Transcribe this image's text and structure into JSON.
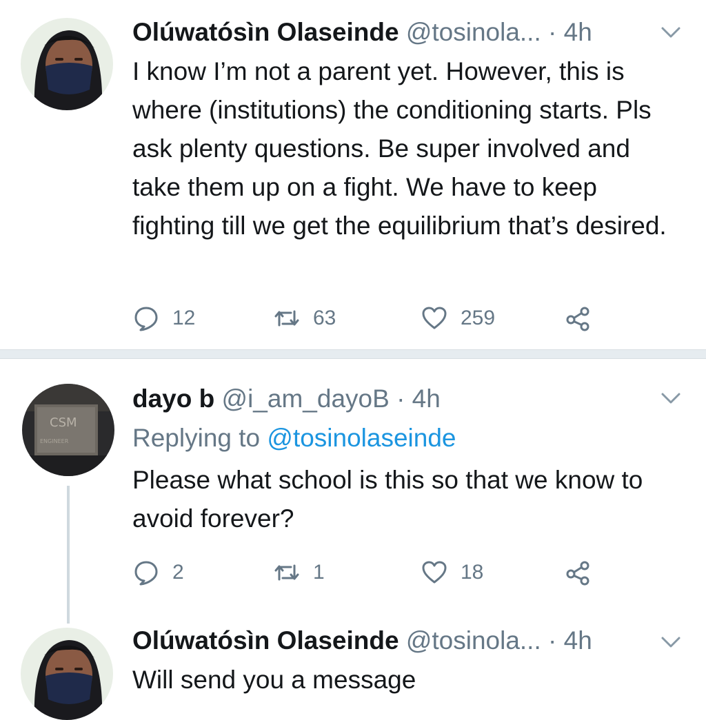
{
  "tweets": [
    {
      "author": "Olúwatósìn Olaseinde",
      "handle": "@tosinola...",
      "dot": "·",
      "time": "4h",
      "body": "I know I’m not a parent yet. However, this is where (institutions) the conditioning starts. Pls ask plenty questions. Be super involved and take them up on a fight. We have to keep fighting till we get the equilibrium that’s desired.",
      "replies": "12",
      "retweets": "63",
      "likes": "259"
    },
    {
      "author": "dayo b",
      "handle": "@i_am_dayoB",
      "dot": "·",
      "time": "4h",
      "replying_label": "Replying to",
      "replying_to": "@tosinolaseinde",
      "body": "Please what school is this so that we know to avoid forever?",
      "replies": "2",
      "retweets": "1",
      "likes": "18"
    },
    {
      "author": "Olúwatósìn Olaseinde",
      "handle": "@tosinola...",
      "dot": "·",
      "time": "4h",
      "body": "Will send you a message"
    }
  ],
  "colors": {
    "text": "#14171a",
    "muted": "#657786",
    "link": "#1b95e0",
    "divider": "#e6ecf0"
  }
}
